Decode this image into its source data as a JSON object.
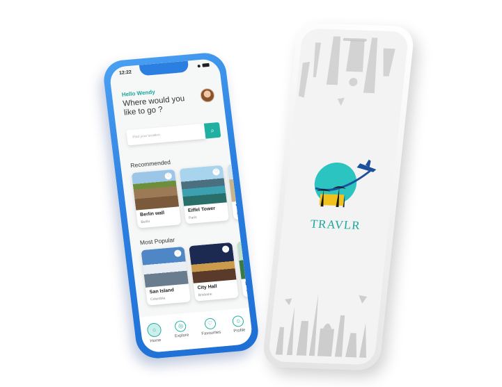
{
  "home": {
    "status": {
      "time": "12:22"
    },
    "greeting": "Hello Wendy",
    "question": "Where would you like to go ?",
    "search": {
      "placeholder": "Find your location"
    },
    "recommended": {
      "title": "Recommended",
      "cards": [
        {
          "title": "Berlin wall",
          "subtitle": "Berlin"
        },
        {
          "title": "Eiffel Tower",
          "subtitle": "Paris"
        },
        {
          "title": "Vic",
          "subtitle": "Mo"
        }
      ]
    },
    "popular": {
      "title": "Most Popular",
      "cards": [
        {
          "title": "San Island",
          "subtitle": "Columbia"
        },
        {
          "title": "City Hall",
          "subtitle": "Brisbane"
        },
        {
          "title": "Ka",
          "subtitle": "Ca"
        }
      ]
    },
    "tabs": [
      {
        "label": "Home",
        "icon": "home-icon"
      },
      {
        "label": "Explore",
        "icon": "compass-icon"
      },
      {
        "label": "Favourites",
        "icon": "heart-icon"
      },
      {
        "label": "Profile",
        "icon": "user-icon"
      }
    ],
    "accent": "#1fb0a2",
    "frame_color": "#2a7fe0"
  },
  "splash": {
    "brand": "TRAVLR",
    "brand_color": "#1aa89b"
  }
}
